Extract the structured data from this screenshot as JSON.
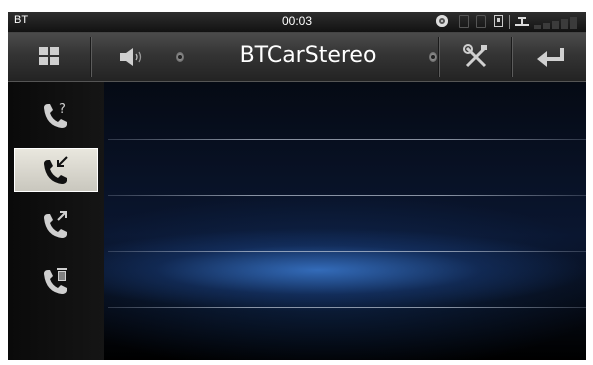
{
  "status_bar": {
    "source_label": "BT",
    "clock": "00:03"
  },
  "title_bar": {
    "title": "BTCarStereo"
  },
  "icons": {
    "menu": "grid-icon",
    "volume": "speaker-icon",
    "settings": "tools-icon",
    "back": "return-arrow-icon"
  },
  "sidebar": {
    "items": [
      {
        "name": "missed-calls",
        "icon": "phone-question-icon",
        "active": false
      },
      {
        "name": "received-calls",
        "icon": "phone-incoming-icon",
        "active": true
      },
      {
        "name": "dialed-calls",
        "icon": "phone-outgoing-icon",
        "active": false
      },
      {
        "name": "delete-call-log",
        "icon": "phone-trash-icon",
        "active": false
      }
    ]
  },
  "call_list": {
    "rows": []
  },
  "colors": {
    "accent_glow": "#3a78cd",
    "active_button": "#e0ded5",
    "icon_color": "#cccccc"
  }
}
